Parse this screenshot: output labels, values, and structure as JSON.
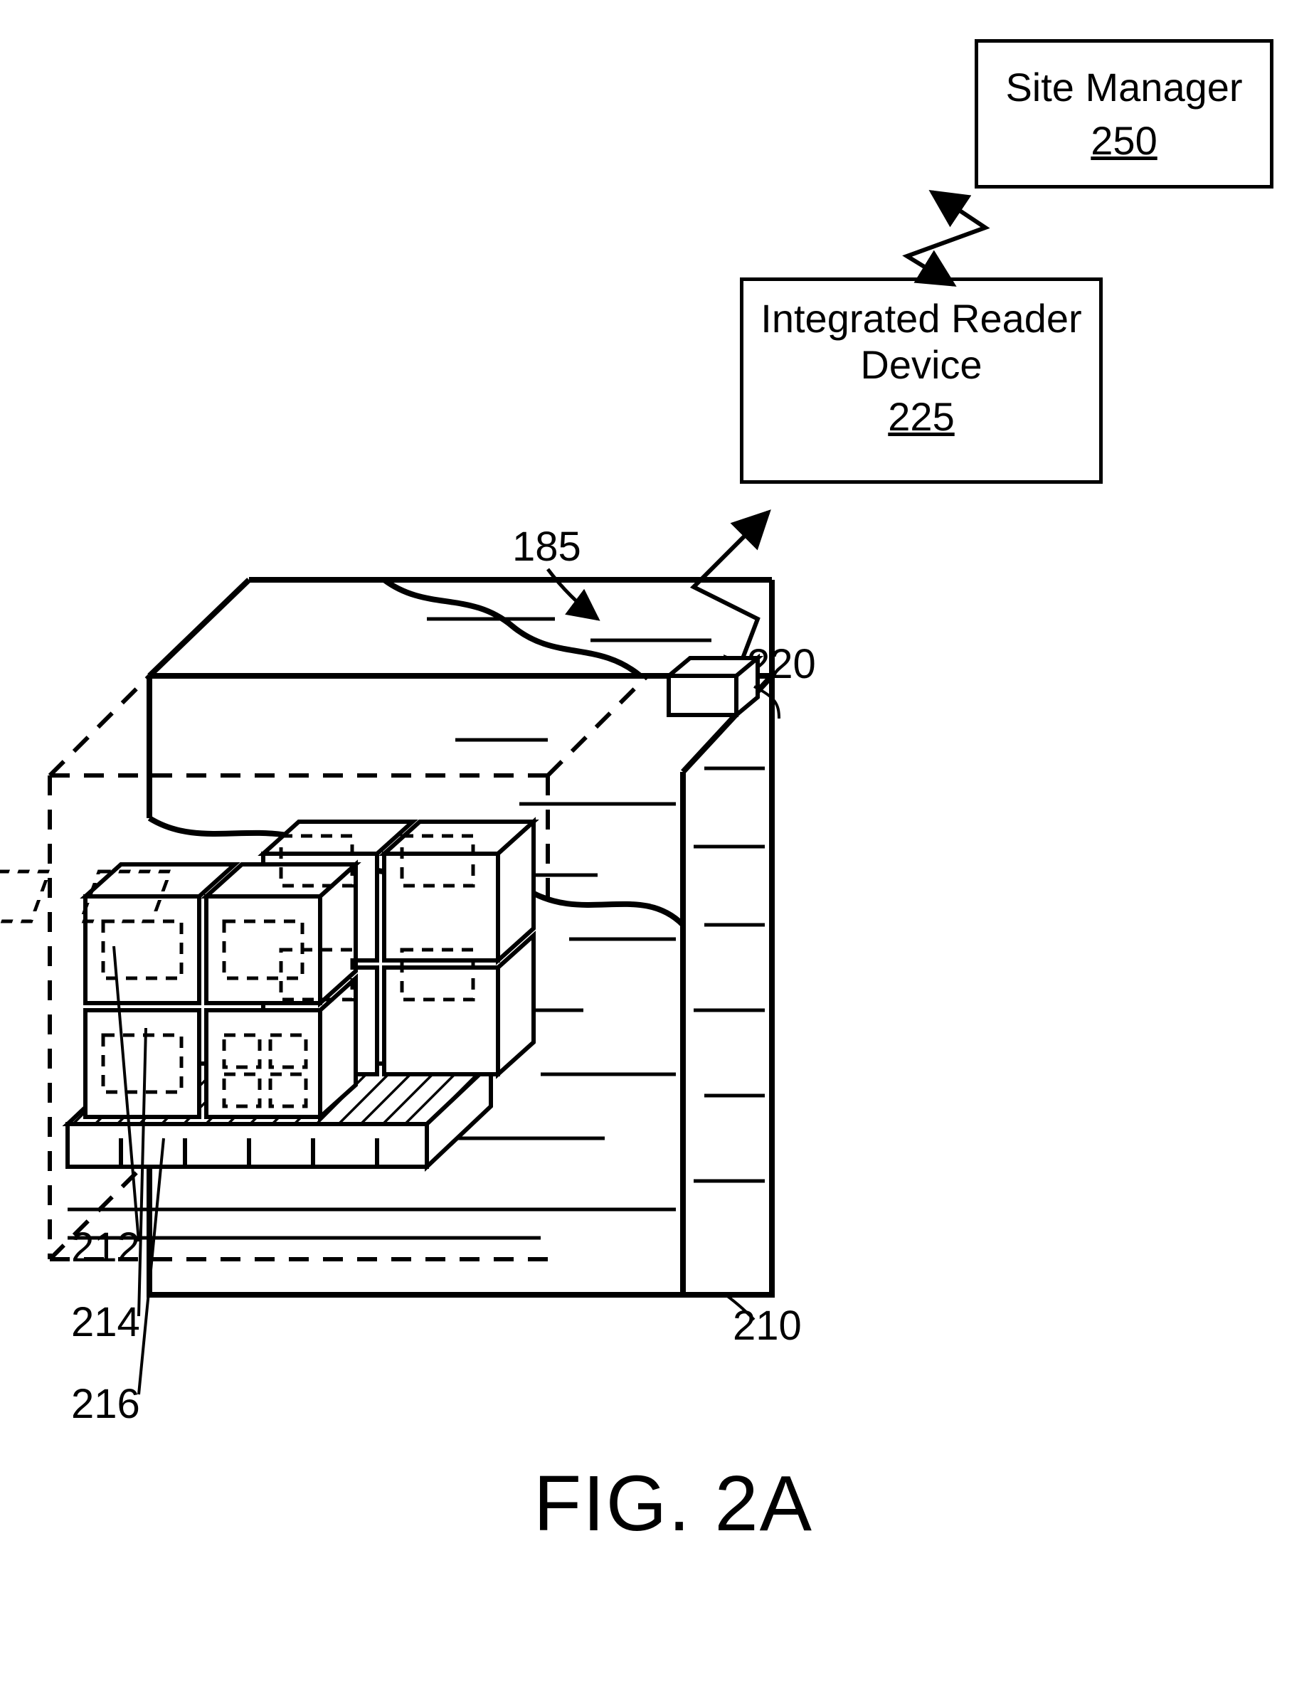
{
  "figure": {
    "label": "FIG. 2A"
  },
  "refs": {
    "r185": "185",
    "r210": "210",
    "r212": "212",
    "r214": "214",
    "r216": "216",
    "r220": "220"
  },
  "boxes": {
    "site_manager": {
      "line1": "Site Manager",
      "num": "250"
    },
    "integrated_reader": {
      "line1": "Integrated Reader",
      "line2": "Device",
      "num": "225"
    }
  }
}
